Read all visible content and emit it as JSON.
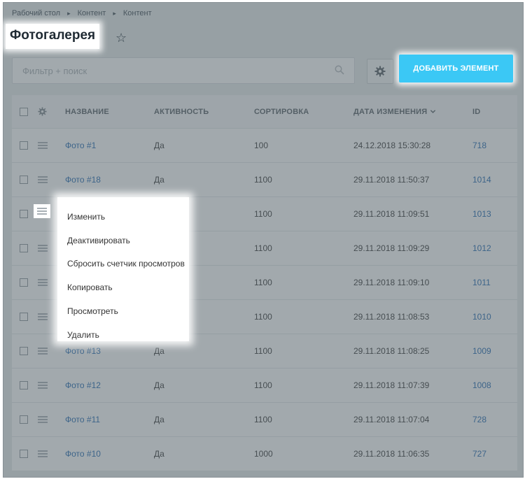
{
  "breadcrumbs": [
    "Рабочий стол",
    "Контент",
    "Контент"
  ],
  "page_title": "Фотогалерея",
  "filter": {
    "placeholder": "Фильтр + поиск"
  },
  "add_button_label": "ДОБАВИТЬ ЭЛЕМЕНТ",
  "table": {
    "headers": {
      "name": "НАЗВАНИЕ",
      "active": "АКТИВНОСТЬ",
      "sort": "СОРТИРОВКА",
      "date": "ДАТА ИЗМЕНЕНИЯ",
      "id": "ID"
    },
    "rows": [
      {
        "name": "Фото #1",
        "active": "Да",
        "sort": "100",
        "date": "24.12.2018 15:30:28",
        "id": "718"
      },
      {
        "name": "Фото #18",
        "active": "Да",
        "sort": "1100",
        "date": "29.11.2018 11:50:37",
        "id": "1014"
      },
      {
        "name": "",
        "active": "",
        "sort": "1100",
        "date": "29.11.2018 11:09:51",
        "id": "1013"
      },
      {
        "name": "",
        "active": "",
        "sort": "1100",
        "date": "29.11.2018 11:09:29",
        "id": "1012"
      },
      {
        "name": "",
        "active": "",
        "sort": "1100",
        "date": "29.11.2018 11:09:10",
        "id": "1011"
      },
      {
        "name": "",
        "active": "",
        "sort": "1100",
        "date": "29.11.2018 11:08:53",
        "id": "1010"
      },
      {
        "name": "Фото #13",
        "active": "Да",
        "sort": "1100",
        "date": "29.11.2018 11:08:25",
        "id": "1009"
      },
      {
        "name": "Фото #12",
        "active": "Да",
        "sort": "1100",
        "date": "29.11.2018 11:07:39",
        "id": "1008"
      },
      {
        "name": "Фото #11",
        "active": "Да",
        "sort": "1100",
        "date": "29.11.2018 11:07:04",
        "id": "728"
      },
      {
        "name": "Фото #10",
        "active": "Да",
        "sort": "1000",
        "date": "29.11.2018 11:06:35",
        "id": "727"
      }
    ]
  },
  "context_menu": [
    "Изменить",
    "Деактивировать",
    "Сбросить счетчик просмотров",
    "Копировать",
    "Просмотреть",
    "Удалить"
  ],
  "colors": {
    "accent": "#3bc8f5",
    "link": "#2067b0"
  },
  "icons": {
    "star": "star-icon",
    "search": "search-icon",
    "gear": "gear-icon",
    "row_menu": "menu-icon",
    "sort": "chevron-down-icon"
  }
}
